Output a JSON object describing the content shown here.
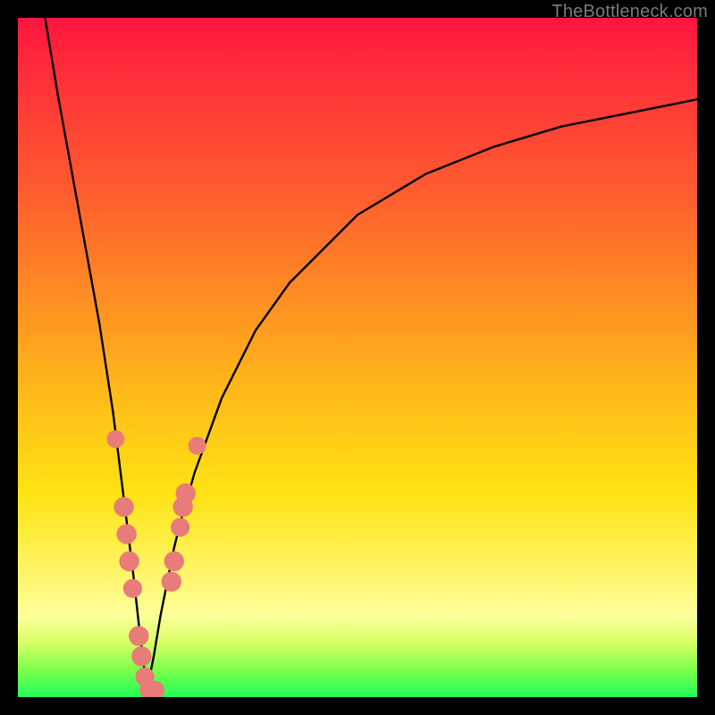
{
  "watermark": "TheBottleneck.com",
  "colors": {
    "frame": "#000000",
    "curve": "#000000",
    "bead_fill": "#e77c78",
    "bead_stroke": "#d66a66",
    "gradient_stops": [
      "#ff143e",
      "#ff2e3a",
      "#ff5a2f",
      "#ff8a24",
      "#ffb91a",
      "#ffe313",
      "#fff56a",
      "#fdff9a",
      "#d7ff66",
      "#7dff4a",
      "#1fff5a"
    ]
  },
  "chart_data": {
    "type": "line",
    "title": "",
    "xlabel": "",
    "ylabel": "",
    "xlim": [
      0,
      100
    ],
    "ylim": [
      0,
      100
    ],
    "grid": false,
    "legend": false,
    "note": "Two black curves forming a V / cusp shape. Left branch descends steeply from top-left to a minimum near x≈19; right branch rises from the same minimum toward upper-right with decreasing slope. Salmon-colored beads cluster along both branches in the lower (yellow/green) band near the trough.",
    "series": [
      {
        "name": "left_branch",
        "x": [
          4,
          6,
          8,
          10,
          12,
          14,
          15,
          16,
          17,
          18,
          19
        ],
        "y": [
          100,
          88,
          77,
          66,
          55,
          42,
          34,
          26,
          18,
          9,
          1
        ]
      },
      {
        "name": "right_branch",
        "x": [
          19,
          20,
          21,
          22,
          23,
          24,
          26,
          30,
          35,
          40,
          50,
          60,
          70,
          80,
          90,
          100
        ],
        "y": [
          1,
          6,
          12,
          17,
          22,
          26,
          33,
          44,
          54,
          61,
          71,
          77,
          81,
          84,
          86,
          88
        ]
      }
    ],
    "beads_left": [
      {
        "x": 14.4,
        "y": 38,
        "r": 1.4
      },
      {
        "x": 15.6,
        "y": 28,
        "r": 1.6
      },
      {
        "x": 16.0,
        "y": 24,
        "r": 1.6
      },
      {
        "x": 16.4,
        "y": 20,
        "r": 1.6
      },
      {
        "x": 16.9,
        "y": 16,
        "r": 1.5
      },
      {
        "x": 17.8,
        "y": 9,
        "r": 1.6
      },
      {
        "x": 18.2,
        "y": 6,
        "r": 1.6
      },
      {
        "x": 18.7,
        "y": 3,
        "r": 1.5
      },
      {
        "x": 19.3,
        "y": 1,
        "r": 1.5
      },
      {
        "x": 20.2,
        "y": 1,
        "r": 1.5
      }
    ],
    "beads_right": [
      {
        "x": 22.6,
        "y": 17,
        "r": 1.6
      },
      {
        "x": 23.0,
        "y": 20,
        "r": 1.6
      },
      {
        "x": 23.9,
        "y": 25,
        "r": 1.5
      },
      {
        "x": 24.3,
        "y": 28,
        "r": 1.6
      },
      {
        "x": 24.7,
        "y": 30,
        "r": 1.6
      },
      {
        "x": 26.4,
        "y": 37,
        "r": 1.4
      }
    ]
  }
}
